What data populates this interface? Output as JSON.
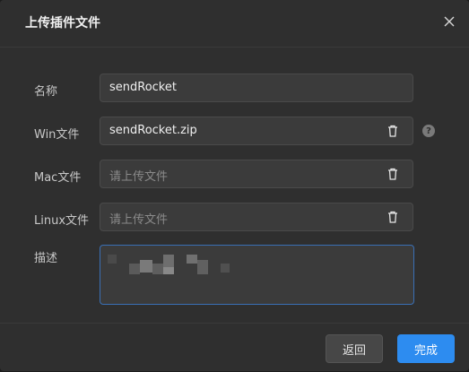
{
  "dialog": {
    "title": "上传插件文件",
    "close_icon": "close-icon"
  },
  "form": {
    "name": {
      "label": "名称",
      "value": "sendRocket"
    },
    "win": {
      "label": "Win文件",
      "value": "sendRocket.zip",
      "help": "?"
    },
    "mac": {
      "label": "Mac文件",
      "placeholder": "请上传文件"
    },
    "linux": {
      "label": "Linux文件",
      "placeholder": "请上传文件"
    },
    "desc": {
      "label": "描述"
    }
  },
  "footer": {
    "back_label": "返回",
    "done_label": "完成"
  },
  "colors": {
    "primary": "#2d8cf0",
    "dialog_bg": "#2f2f2f",
    "input_bg": "#3b3b3b"
  }
}
